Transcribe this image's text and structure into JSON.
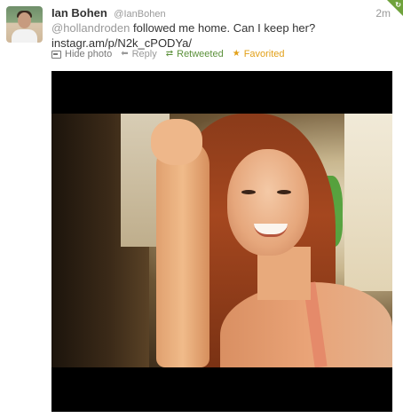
{
  "tweet": {
    "author_name": "Ian Bohen",
    "author_username": "@IanBohen",
    "timestamp": "2m",
    "mention": "@hollandroden",
    "text": " followed me home. Can I keep her?",
    "link": "instagr.am/p/N2k_cPODYa/",
    "corner_badge_icon": "retweet-badge-icon"
  },
  "actions": {
    "hide_photo": "Hide photo",
    "reply": "Reply",
    "retweeted": "Retweeted",
    "favorited": "Favorited"
  },
  "colors": {
    "retweeted": "#5c913b",
    "favorited": "#e2a018",
    "muted": "#999999"
  },
  "photo": {
    "description_icon": "photo-icon"
  }
}
